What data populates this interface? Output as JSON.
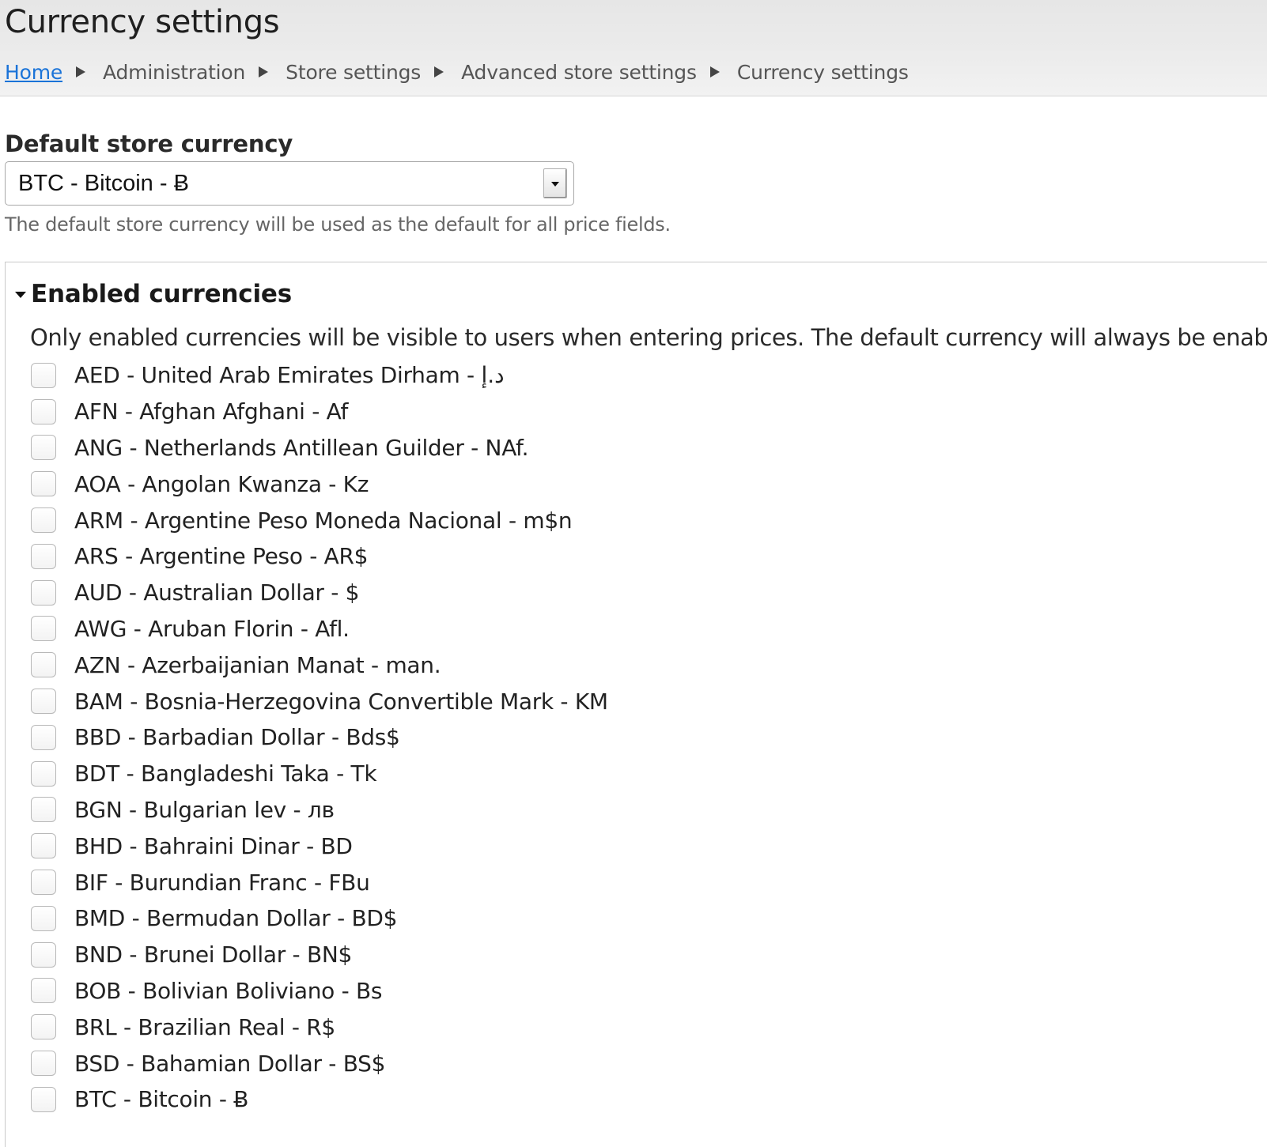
{
  "page": {
    "title": "Currency settings"
  },
  "breadcrumb": {
    "items": [
      {
        "label": "Home",
        "link": true
      },
      {
        "label": "Administration",
        "link": false
      },
      {
        "label": "Store settings",
        "link": false
      },
      {
        "label": "Advanced store settings",
        "link": false
      },
      {
        "label": "Currency settings",
        "link": false
      }
    ]
  },
  "default_currency": {
    "label": "Default store currency",
    "selected": "BTC - Bitcoin - Ƀ",
    "description": "The default store currency will be used as the default for all price fields."
  },
  "enabled_currencies": {
    "title": "Enabled currencies",
    "expanded": true,
    "description": "Only enabled currencies will be visible to users when entering prices. The default currency will always be enabled.",
    "items": [
      {
        "label": "AED - United Arab Emirates Dirham - د.إ",
        "checked": false
      },
      {
        "label": "AFN - Afghan Afghani - Af",
        "checked": false
      },
      {
        "label": "ANG - Netherlands Antillean Guilder - NAf.",
        "checked": false
      },
      {
        "label": "AOA - Angolan Kwanza - Kz",
        "checked": false
      },
      {
        "label": "ARM - Argentine Peso Moneda Nacional - m$n",
        "checked": false
      },
      {
        "label": "ARS - Argentine Peso - AR$",
        "checked": false
      },
      {
        "label": "AUD - Australian Dollar - $",
        "checked": false
      },
      {
        "label": "AWG - Aruban Florin - Afl.",
        "checked": false
      },
      {
        "label": "AZN - Azerbaijanian Manat - man.",
        "checked": false
      },
      {
        "label": "BAM - Bosnia-Herzegovina Convertible Mark - KM",
        "checked": false
      },
      {
        "label": "BBD - Barbadian Dollar - Bds$",
        "checked": false
      },
      {
        "label": "BDT - Bangladeshi Taka - Tk",
        "checked": false
      },
      {
        "label": "BGN - Bulgarian lev - лв",
        "checked": false
      },
      {
        "label": "BHD - Bahraini Dinar - BD",
        "checked": false
      },
      {
        "label": "BIF - Burundian Franc - FBu",
        "checked": false
      },
      {
        "label": "BMD - Bermudan Dollar - BD$",
        "checked": false
      },
      {
        "label": "BND - Brunei Dollar - BN$",
        "checked": false
      },
      {
        "label": "BOB - Bolivian Boliviano - Bs",
        "checked": false
      },
      {
        "label": "BRL - Brazilian Real - R$",
        "checked": false
      },
      {
        "label": "BSD - Bahamian Dollar - BS$",
        "checked": false
      },
      {
        "label": "BTC - Bitcoin - Ƀ",
        "checked": false
      }
    ]
  }
}
